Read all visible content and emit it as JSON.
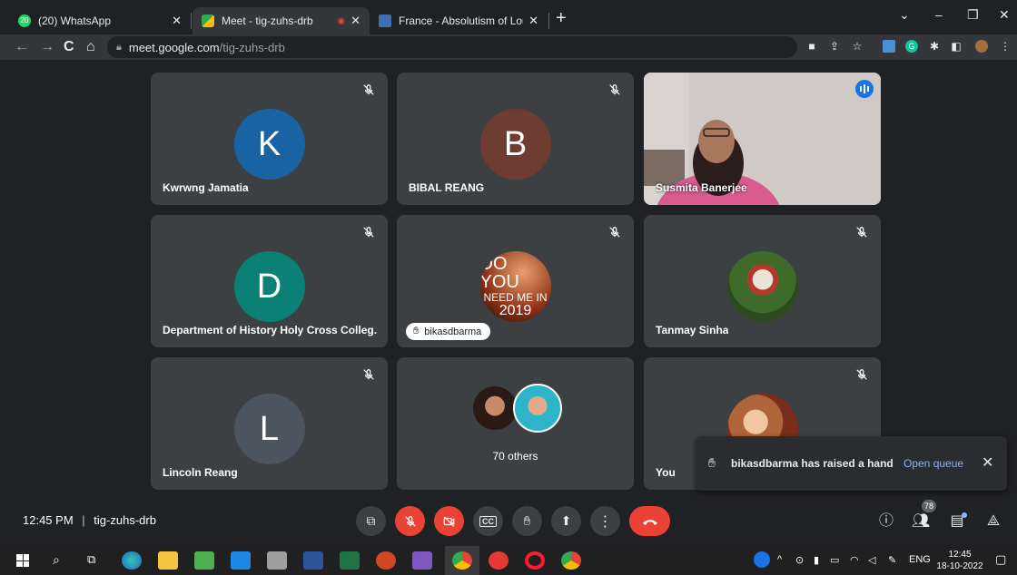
{
  "browser": {
    "tabs": [
      {
        "title": "(20) WhatsApp",
        "active": false
      },
      {
        "title": "Meet - tig-zuhs-drb",
        "active": true
      },
      {
        "title": "France - Absolutism of Louis | Bri",
        "active": false
      }
    ],
    "url_domain": "meet.google.com",
    "url_path": "/tig-zuhs-drb",
    "whatsapp_badge": "20"
  },
  "meet": {
    "participants": [
      {
        "name": "Kwrwng Jamatia",
        "initial": "K",
        "color": "#1a63a3",
        "muted": true
      },
      {
        "name": "BIBAL REANG",
        "initial": "B",
        "color": "#6d3c32",
        "muted": true
      },
      {
        "name": "Susmita Banerjee",
        "initial": "",
        "color": "#8a7d74",
        "muted": false,
        "speaking": true
      },
      {
        "name": "Department of History Holy Cross Colleg...",
        "initial": "D",
        "color": "#0b8074",
        "muted": true
      },
      {
        "name": "bikasdbarma",
        "initial": "",
        "color": "#6b2b17",
        "muted": true,
        "photo_text": [
          "DO YOU",
          "NEED ME IN",
          "2019"
        ],
        "hand_raised": true
      },
      {
        "name": "Tanmay Sinha",
        "initial": "",
        "color": "#4b6b2e",
        "muted": true
      },
      {
        "name": "Lincoln Reang",
        "initial": "L",
        "color": "#4a5560",
        "muted": true
      },
      {
        "name": "70 others",
        "initial": "",
        "color": "#3c4043",
        "muted": false
      },
      {
        "name": "You",
        "initial": "",
        "color": "#c88a4a",
        "muted": true
      }
    ],
    "time": "12:45 PM",
    "separator": "|",
    "meeting_code": "tig-zuhs-drb",
    "people_count": "78",
    "toast": {
      "message": "bikasdbarma has raised a hand",
      "action": "Open queue"
    }
  },
  "taskbar": {
    "language": "ENG",
    "clock_time": "12:45",
    "clock_date": "18-10-2022"
  },
  "colors": {
    "page_bg": "#202124",
    "tile_bg": "#3c4043",
    "accent": "#8ab4f8",
    "red": "#ea4335"
  }
}
